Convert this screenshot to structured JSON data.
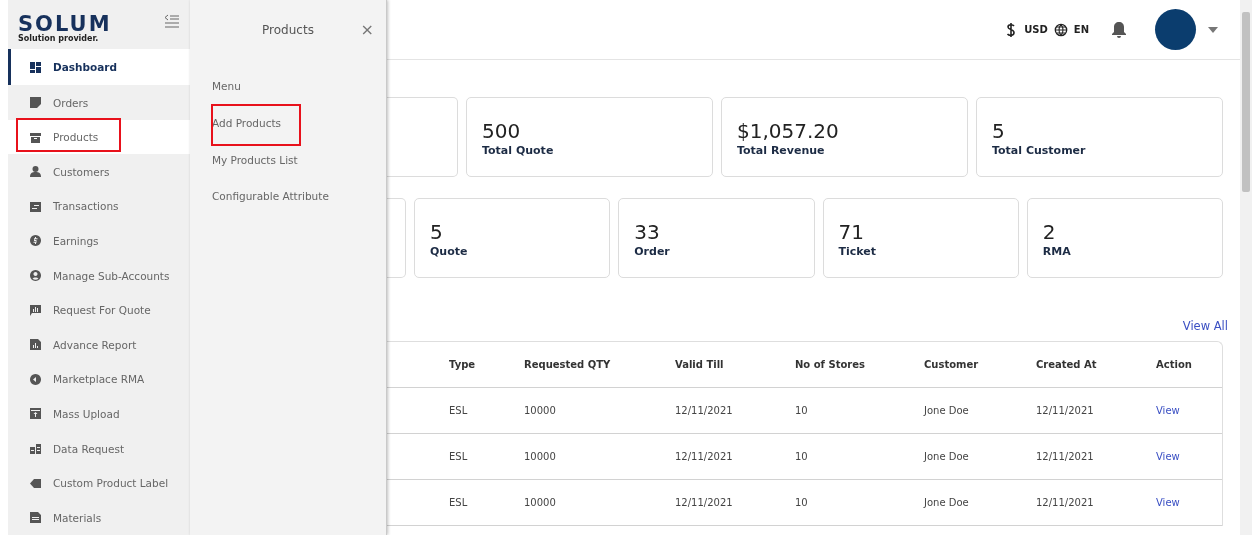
{
  "logo": {
    "name": "SOLUM",
    "tagline": "Solution provider."
  },
  "sidebar": {
    "items": [
      {
        "label": "Dashboard",
        "selected": true,
        "expanded": false,
        "annotated": false
      },
      {
        "label": "Orders",
        "selected": false,
        "expanded": false,
        "annotated": false
      },
      {
        "label": "Products",
        "selected": false,
        "expanded": true,
        "annotated": true
      },
      {
        "label": "Customers",
        "selected": false,
        "expanded": false,
        "annotated": false
      },
      {
        "label": "Transactions",
        "selected": false,
        "expanded": false,
        "annotated": false
      },
      {
        "label": "Earnings",
        "selected": false,
        "expanded": false,
        "annotated": false
      },
      {
        "label": "Manage Sub-Accounts",
        "selected": false,
        "expanded": false,
        "annotated": false
      },
      {
        "label": "Request For Quote",
        "selected": false,
        "expanded": false,
        "annotated": false
      },
      {
        "label": "Advance Report",
        "selected": false,
        "expanded": false,
        "annotated": false
      },
      {
        "label": "Marketplace RMA",
        "selected": false,
        "expanded": false,
        "annotated": false
      },
      {
        "label": "Mass Upload",
        "selected": false,
        "expanded": false,
        "annotated": false
      },
      {
        "label": "Data Request",
        "selected": false,
        "expanded": false,
        "annotated": false
      },
      {
        "label": "Custom Product Label",
        "selected": false,
        "expanded": false,
        "annotated": false
      },
      {
        "label": "Materials",
        "selected": false,
        "expanded": false,
        "annotated": false
      }
    ]
  },
  "submenu": {
    "title": "Products",
    "close": "×",
    "items": [
      {
        "label": "Menu",
        "annotated": false
      },
      {
        "label": "Add Products",
        "annotated": true
      },
      {
        "label": "My Products List",
        "annotated": false
      },
      {
        "label": "Configurable Attribute",
        "annotated": false
      }
    ]
  },
  "topbar": {
    "currency": "USD",
    "language": "EN"
  },
  "summary_cards": [
    {
      "value": "500",
      "label": "Total Quote"
    },
    {
      "value": "$1,057.20",
      "label": "Total Revenue"
    },
    {
      "value": "5",
      "label": "Total Customer"
    }
  ],
  "count_cards": [
    {
      "value": "5",
      "label": "Quote"
    },
    {
      "value": "33",
      "label": "Order"
    },
    {
      "value": "71",
      "label": "Ticket"
    },
    {
      "value": "2",
      "label": "RMA"
    }
  ],
  "view_all": "View All",
  "table": {
    "columns": [
      "Type",
      "Requested QTY",
      "Valid Till",
      "No of Stores",
      "Customer",
      "Created At",
      "Action"
    ],
    "rows": [
      [
        "ESL",
        "10000",
        "12/11/2021",
        "10",
        "Jone Doe",
        "12/11/2021",
        "View"
      ],
      [
        "ESL",
        "10000",
        "12/11/2021",
        "10",
        "Jone Doe",
        "12/11/2021",
        "View"
      ],
      [
        "ESL",
        "10000",
        "12/11/2021",
        "10",
        "Jone Doe",
        "12/11/2021",
        "View"
      ]
    ]
  }
}
